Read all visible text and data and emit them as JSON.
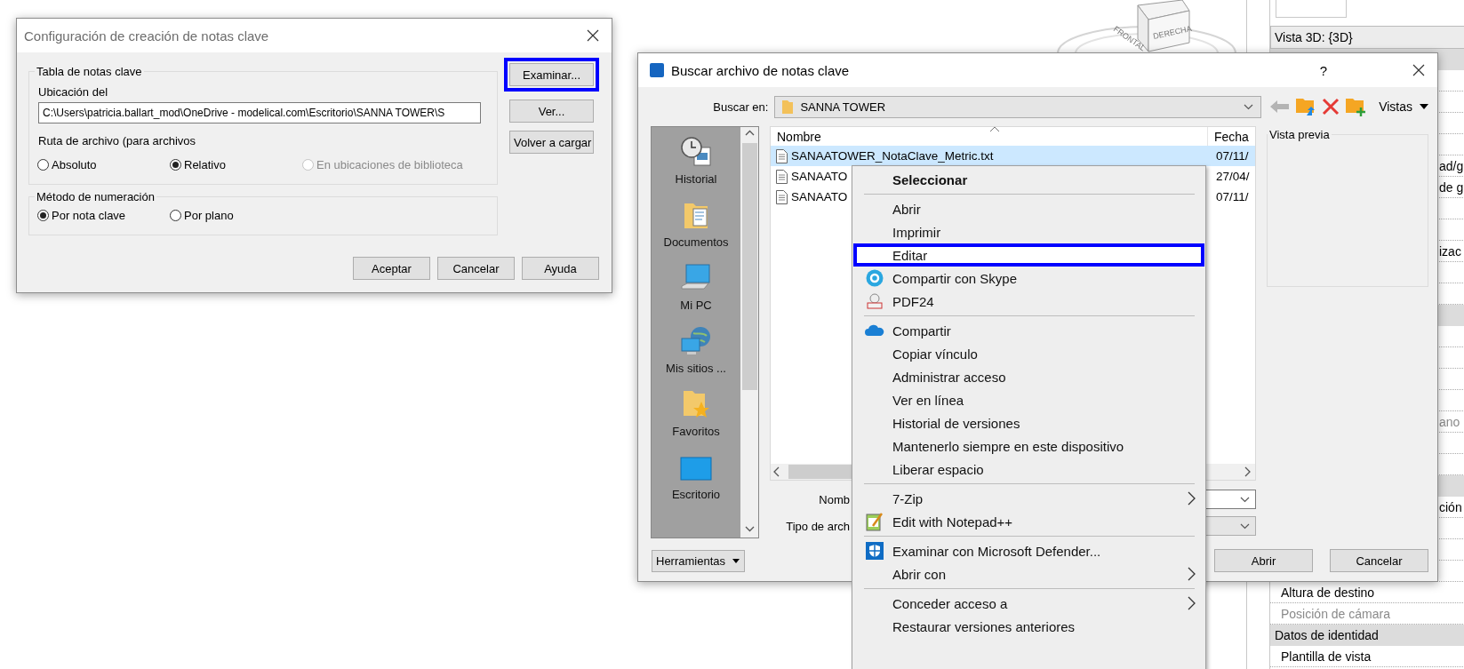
{
  "view_cube": {
    "labels": [
      "FRONTAL",
      "DERECHA"
    ]
  },
  "settings_dialog": {
    "title": "Configuración de creación de notas clave",
    "table_group": {
      "legend": "Tabla de notas clave",
      "location_label": "Ubicación del",
      "location_value": "C:\\Users\\patricia.ballart_mod\\OneDrive - modelical.com\\Escritorio\\SANNA TOWER\\S",
      "path_label": "Ruta de archivo (para archivos",
      "path_options": [
        {
          "label": "Absoluto",
          "selected": false,
          "disabled": false
        },
        {
          "label": "Relativo",
          "selected": true,
          "disabled": false
        },
        {
          "label": "En ubicaciones de biblioteca",
          "selected": false,
          "disabled": true
        }
      ]
    },
    "numbering_group": {
      "legend": "Método de numeración",
      "options": [
        {
          "label": "Por nota clave",
          "selected": true
        },
        {
          "label": "Por plano",
          "selected": false
        }
      ]
    },
    "side_buttons": [
      {
        "label": "Examinar...",
        "highlighted": true
      },
      {
        "label": "Ver...",
        "highlighted": false
      },
      {
        "label": "Volver a cargar",
        "highlighted": false
      }
    ],
    "buttons": [
      "Aceptar",
      "Cancelar",
      "Ayuda"
    ]
  },
  "browse_dialog": {
    "title": "Buscar archivo de notas clave",
    "help": "?",
    "look_in_label": "Buscar en:",
    "look_in_value": "SANNA TOWER",
    "views_label": "Vistas",
    "places": [
      {
        "label": "Historial",
        "kind": "history"
      },
      {
        "label": "Documentos",
        "kind": "documents"
      },
      {
        "label": "Mi PC",
        "kind": "computer"
      },
      {
        "label": "Mis sitios ...",
        "kind": "network"
      },
      {
        "label": "Favoritos",
        "kind": "favorites"
      },
      {
        "label": "Escritorio",
        "kind": "desktop"
      }
    ],
    "columns": [
      "Nombre",
      "Fecha"
    ],
    "files": [
      {
        "name": "SANAATOWER_NotaClave_Metric.txt",
        "date": "07/11/",
        "selected": true
      },
      {
        "name": "SANAATO",
        "date": "27/04/",
        "selected": false
      },
      {
        "name": "SANAATO",
        "date": "07/11/",
        "selected": false
      }
    ],
    "file_name_label": "Nomb",
    "file_type_label": "Tipo de arch",
    "preview_label": "Vista previa",
    "tools_button": "Herramientas",
    "open_button": "Abrir",
    "cancel_button": "Cancelar"
  },
  "context_menu": {
    "items": [
      {
        "kind": "item",
        "label": "Seleccionar",
        "default": true,
        "highlighted": false,
        "submenu": false
      },
      {
        "kind": "separator"
      },
      {
        "kind": "item",
        "label": "Abrir",
        "default": false,
        "highlighted": false,
        "submenu": false
      },
      {
        "kind": "item",
        "label": "Imprimir",
        "default": false,
        "highlighted": false,
        "submenu": false
      },
      {
        "kind": "item",
        "label": "Editar",
        "default": false,
        "highlighted": true,
        "submenu": false
      },
      {
        "kind": "skype",
        "label": "Compartir con Skype",
        "default": false,
        "highlighted": false,
        "submenu": false
      },
      {
        "kind": "pdf",
        "label": "PDF24",
        "default": false,
        "highlighted": false,
        "submenu": false
      },
      {
        "kind": "separator"
      },
      {
        "kind": "cloud",
        "label": "Compartir",
        "default": false,
        "highlighted": false,
        "submenu": false
      },
      {
        "kind": "item",
        "label": "Copiar vínculo",
        "default": false,
        "highlighted": false,
        "submenu": false
      },
      {
        "kind": "item",
        "label": "Administrar acceso",
        "default": false,
        "highlighted": false,
        "submenu": false
      },
      {
        "kind": "item",
        "label": "Ver en línea",
        "default": false,
        "highlighted": false,
        "submenu": false
      },
      {
        "kind": "item",
        "label": "Historial de versiones",
        "default": false,
        "highlighted": false,
        "submenu": false
      },
      {
        "kind": "item",
        "label": "Mantenerlo siempre en este dispositivo",
        "default": false,
        "highlighted": false,
        "submenu": false
      },
      {
        "kind": "item",
        "label": "Liberar espacio",
        "default": false,
        "highlighted": false,
        "submenu": false
      },
      {
        "kind": "separator"
      },
      {
        "kind": "item",
        "label": "7-Zip",
        "default": false,
        "highlighted": false,
        "submenu": true
      },
      {
        "kind": "notepad",
        "label": "Edit with Notepad++",
        "default": false,
        "highlighted": false,
        "submenu": false
      },
      {
        "kind": "separator"
      },
      {
        "kind": "shield",
        "label": "Examinar con Microsoft Defender...",
        "default": false,
        "highlighted": false,
        "submenu": false
      },
      {
        "kind": "item",
        "label": "Abrir con",
        "default": false,
        "highlighted": false,
        "submenu": true
      },
      {
        "kind": "separator"
      },
      {
        "kind": "item",
        "label": "Conceder acceso a",
        "default": false,
        "highlighted": false,
        "submenu": true
      },
      {
        "kind": "item",
        "label": "Restaurar versiones anteriores",
        "default": false,
        "highlighted": false,
        "submenu": false
      }
    ]
  },
  "properties_panel": {
    "view_selector": "Vista 3D: {3D}",
    "rows": [
      {
        "kind": "header"
      },
      {
        "kind": "row"
      },
      {
        "kind": "row"
      },
      {
        "kind": "row"
      },
      {
        "kind": "row"
      },
      {
        "kind": "partial",
        "text": "ad/g",
        "disabled": false
      },
      {
        "kind": "partial",
        "text": "de g",
        "disabled": false
      },
      {
        "kind": "row"
      },
      {
        "kind": "row"
      },
      {
        "kind": "partial",
        "text": "izac",
        "disabled": false
      },
      {
        "kind": "row"
      },
      {
        "kind": "row"
      },
      {
        "kind": "header"
      },
      {
        "kind": "row"
      },
      {
        "kind": "row"
      },
      {
        "kind": "row"
      },
      {
        "kind": "row"
      },
      {
        "kind": "partial",
        "text": "ano",
        "disabled": true
      },
      {
        "kind": "row"
      },
      {
        "kind": "row"
      },
      {
        "kind": "header"
      },
      {
        "kind": "partial",
        "text": "ción",
        "disabled": false
      },
      {
        "kind": "row"
      },
      {
        "kind": "row"
      },
      {
        "kind": "row"
      },
      {
        "kind": "row",
        "text": "Altura de destino",
        "disabled": false
      },
      {
        "kind": "row",
        "text": "Posición de cámara",
        "disabled": true
      },
      {
        "kind": "header",
        "text": "Datos de identidad"
      },
      {
        "kind": "row",
        "text": "Plantilla de vista",
        "disabled": false
      }
    ]
  }
}
